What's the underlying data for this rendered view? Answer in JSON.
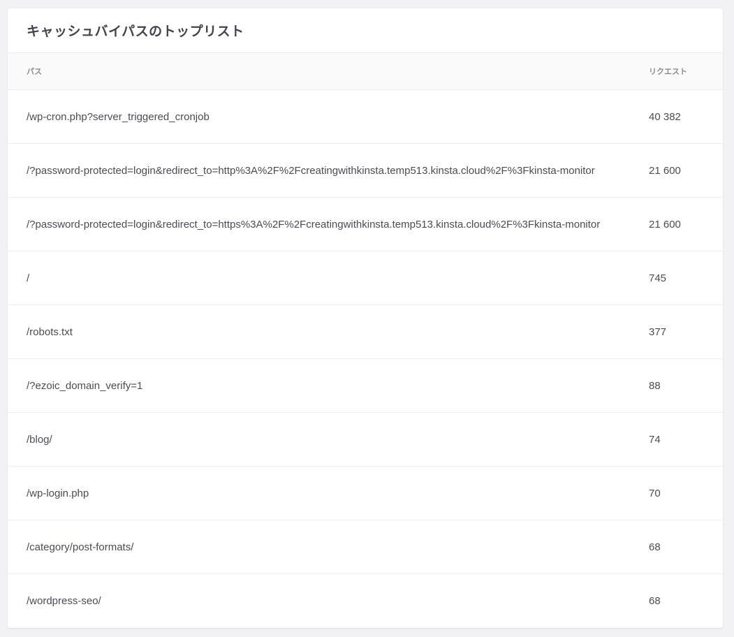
{
  "card": {
    "title": "キャッシュバイパスのトップリスト"
  },
  "table": {
    "headers": {
      "path": "パス",
      "requests": "リクエスト"
    },
    "rows": [
      {
        "path": "/wp-cron.php?server_triggered_cronjob",
        "requests": "40 382"
      },
      {
        "path": "/?password-protected=login&redirect_to=http%3A%2F%2Fcreatingwithkinsta.temp513.kinsta.cloud%2F%3Fkinsta-monitor",
        "requests": "21 600"
      },
      {
        "path": "/?password-protected=login&redirect_to=https%3A%2F%2Fcreatingwithkinsta.temp513.kinsta.cloud%2F%3Fkinsta-monitor",
        "requests": "21 600"
      },
      {
        "path": "/",
        "requests": "745"
      },
      {
        "path": "/robots.txt",
        "requests": "377"
      },
      {
        "path": "/?ezoic_domain_verify=1",
        "requests": "88"
      },
      {
        "path": "/blog/",
        "requests": "74"
      },
      {
        "path": "/wp-login.php",
        "requests": "70"
      },
      {
        "path": "/category/post-formats/",
        "requests": "68"
      },
      {
        "path": "/wordpress-seo/",
        "requests": "68"
      }
    ]
  }
}
